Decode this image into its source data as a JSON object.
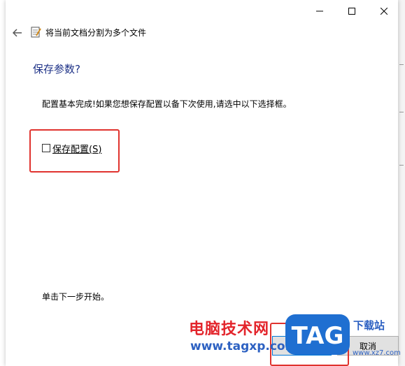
{
  "window": {
    "minimize_icon": "minimize-icon",
    "maximize_icon": "maximize-icon",
    "close_icon": "close-icon"
  },
  "wizard": {
    "title": "将当前文档分割为多个文件",
    "heading": "保存参数?",
    "description": "配置基本完成!如果您想保存配置以备下次使用,请选中以下选择框。",
    "checkbox_label": "保存配置(S)",
    "checkbox_checked": false,
    "hint": "单击下一步开始。",
    "next_label": "",
    "cancel_label": "取消"
  },
  "watermark": {
    "line1": "电脑技术网",
    "line2": "www.tagxp.com",
    "logo": "TAG",
    "line3": "下载站",
    "line4": "www.xz7.com"
  },
  "colors": {
    "heading": "#1e3287",
    "highlight": "#e0332e",
    "watermark_red": "#e3242b",
    "watermark_blue": "#2d61c2"
  }
}
